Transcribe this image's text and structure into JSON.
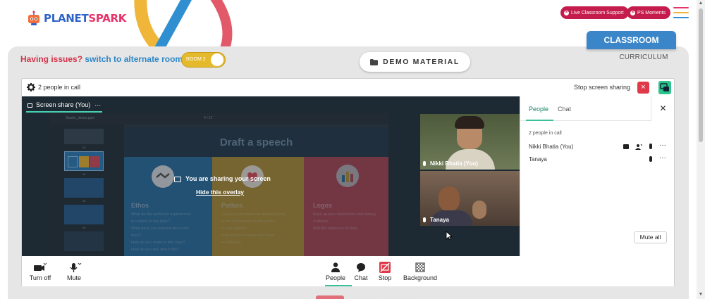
{
  "brand": {
    "name_part1": "PLANET",
    "name_part2": "SPARK"
  },
  "header": {
    "live_support_label": "Live Classroom Support",
    "ps_moments_label": "PS Moments"
  },
  "nav": {
    "classroom_tab": "CLASSROOM",
    "curriculum_tab": "CURRICULUM"
  },
  "issues_bar": {
    "issue_text": "Having issues?",
    "switch_text": "switch to alternate room",
    "room_toggle_label": "ROOM 2"
  },
  "demo_material_label": "DEMO MATERIAL",
  "meeting": {
    "people_in_call": "2 people in call",
    "stop_sharing_label": "Stop screen sharing",
    "screen_share_tab": "Screen share (You)",
    "overlay_message": "You are sharing your screen",
    "overlay_hide_link": "Hide this overlay",
    "participants_video": [
      {
        "name": "Nikki Bhatia (You)"
      },
      {
        "name": "Tanaya"
      }
    ],
    "slide": {
      "file_name": "Starter_demo.pptx",
      "page_indicator": "4 / 17",
      "title": "Draft a speech",
      "thumb_numbers": [
        "03",
        "04",
        "05",
        "06"
      ],
      "columns": [
        {
          "heading": "Ethos",
          "color": "#2e7db5",
          "lines": [
            "What do the audience experiences",
            "in relation to the topic?",
            "What have you learned about this",
            "topic?",
            "How do you relate to this topic?",
            "How do you feel about this?"
          ]
        },
        {
          "heading": "Pathos",
          "color": "#e6b130",
          "lines": [
            "How you can make the audience feel",
            "a mix of emotions as they listen",
            "to your speech",
            "How do you connect with them",
            "emotionally"
          ]
        },
        {
          "heading": "Logos",
          "color": "#d84a5a",
          "lines": [
            "Back up your statements with strong",
            "evidence",
            "Add the reference of stats"
          ]
        }
      ]
    },
    "side_panel": {
      "tabs": [
        "People",
        "Chat"
      ],
      "active_tab": "People",
      "count_line": "2 people in call",
      "participants": [
        "Nikki Bhatia (You)",
        "Tanaya"
      ],
      "mute_all_label": "Mute all"
    },
    "controls": {
      "camera_label": "Turn off",
      "mic_label": "Mute",
      "people_label": "People",
      "chat_label": "Chat",
      "stop_label": "Stop",
      "background_label": "Background"
    }
  },
  "colors": {
    "brand_pink": "#c41c4c",
    "brand_blue": "#3a86c8",
    "toggle_yellow": "#e5b92c",
    "accent_green": "#3bbf9a",
    "stop_red": "#e03a4a"
  },
  "icons": [
    "settings-icon",
    "more-icon",
    "close-icon",
    "present-icon",
    "camera-icon",
    "mic-icon",
    "people-icon",
    "chat-icon",
    "stop-share-icon",
    "background-icon",
    "folder-icon",
    "menu-icon"
  ]
}
